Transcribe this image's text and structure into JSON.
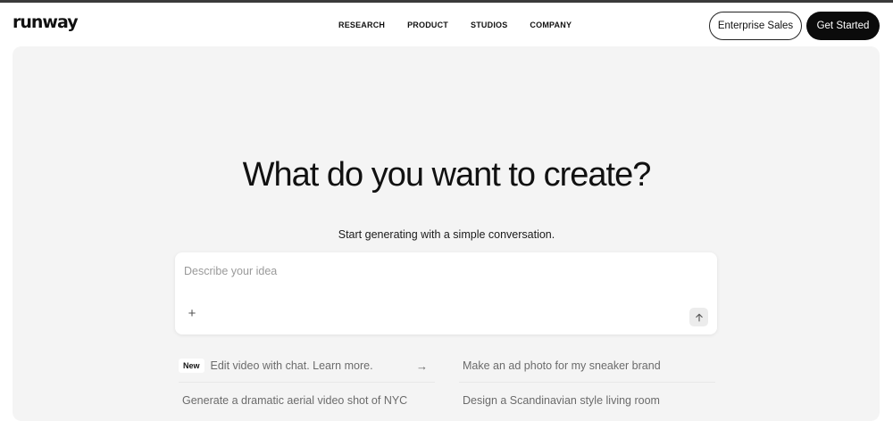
{
  "nav": {
    "logo": "runway",
    "menu": [
      "RESEARCH",
      "PRODUCT",
      "STUDIOS",
      "COMPANY"
    ],
    "enterprise_label": "Enterprise Sales",
    "get_started_label": "Get Started"
  },
  "hero": {
    "title": "What do you want to create?",
    "subtitle": "Start generating with a simple conversation.",
    "input_placeholder": "Describe your idea",
    "input_value": ""
  },
  "suggestions": {
    "left": [
      {
        "badge": "New",
        "text": "Edit video with chat. Learn more."
      },
      {
        "badge": "",
        "text": "Generate a dramatic aerial video shot of NYC"
      }
    ],
    "right": [
      {
        "text": "Make an ad photo for my sneaker brand"
      },
      {
        "text": "Design a Scandinavian style living room"
      }
    ]
  },
  "icons": {
    "add": "plus-icon",
    "send": "arrow-up-icon",
    "suggestion_go": "arrow-right-icon"
  },
  "colors": {
    "hero_background": "#f4f4f4",
    "primary_button": "#0b0b0b",
    "placeholder": "#9a9a9a"
  }
}
